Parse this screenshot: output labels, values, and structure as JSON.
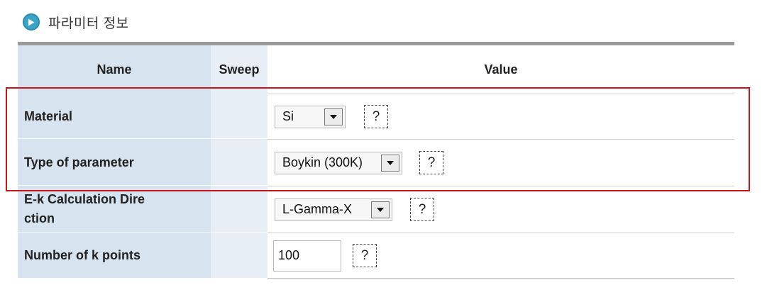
{
  "section": {
    "title": "파라미터 정보",
    "icon": "play-circle-icon",
    "accent_color": "#3aa3c6"
  },
  "table": {
    "headers": {
      "name": "Name",
      "sweep": "Sweep",
      "value": "Value"
    },
    "rows": [
      {
        "name": "Material",
        "type": "select",
        "value": "Si",
        "help": "?"
      },
      {
        "name": "Type of parameter",
        "type": "select",
        "value": "Boykin (300K)",
        "help": "?"
      },
      {
        "name_line1": "E-k Calculation Dire",
        "name_line2": "ction",
        "type": "select",
        "value": "L-Gamma-X",
        "help": "?"
      },
      {
        "name": "Number of k points",
        "type": "text",
        "value": "100",
        "help": "?"
      }
    ]
  },
  "highlight": {
    "color": "#c8151b"
  }
}
